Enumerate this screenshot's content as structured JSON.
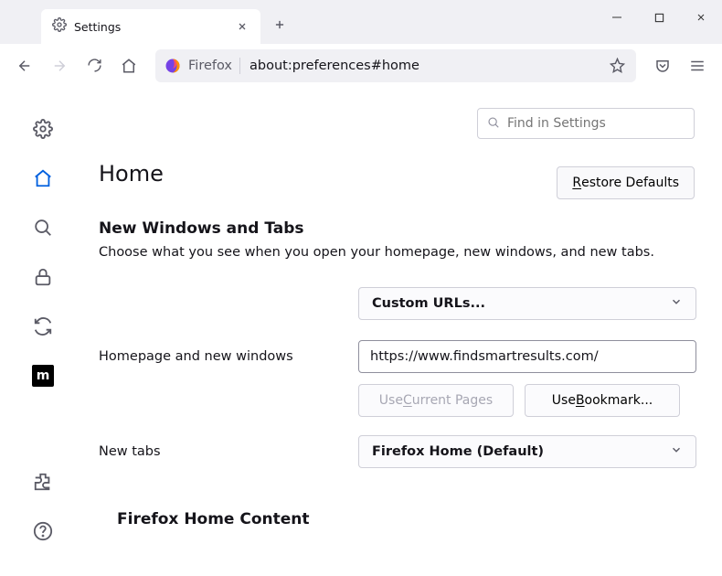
{
  "tab": {
    "title": "Settings"
  },
  "urlbar": {
    "label": "Firefox",
    "address": "about:preferences#home"
  },
  "search": {
    "placeholder": "Find in Settings"
  },
  "page": {
    "title": "Home",
    "restore": "Restore Defaults"
  },
  "section": {
    "heading": "New Windows and Tabs",
    "desc": "Choose what you see when you open your homepage, new windows, and new tabs."
  },
  "homepage": {
    "label": "Homepage and new windows",
    "select": "Custom URLs...",
    "value": "https://www.findsmartresults.com/",
    "useCurrent": "Use Current Pages",
    "useBookmark": "Use Bookmark..."
  },
  "newtabs": {
    "label": "New tabs",
    "select": "Firefox Home (Default)"
  },
  "subsection": "Firefox Home Content"
}
